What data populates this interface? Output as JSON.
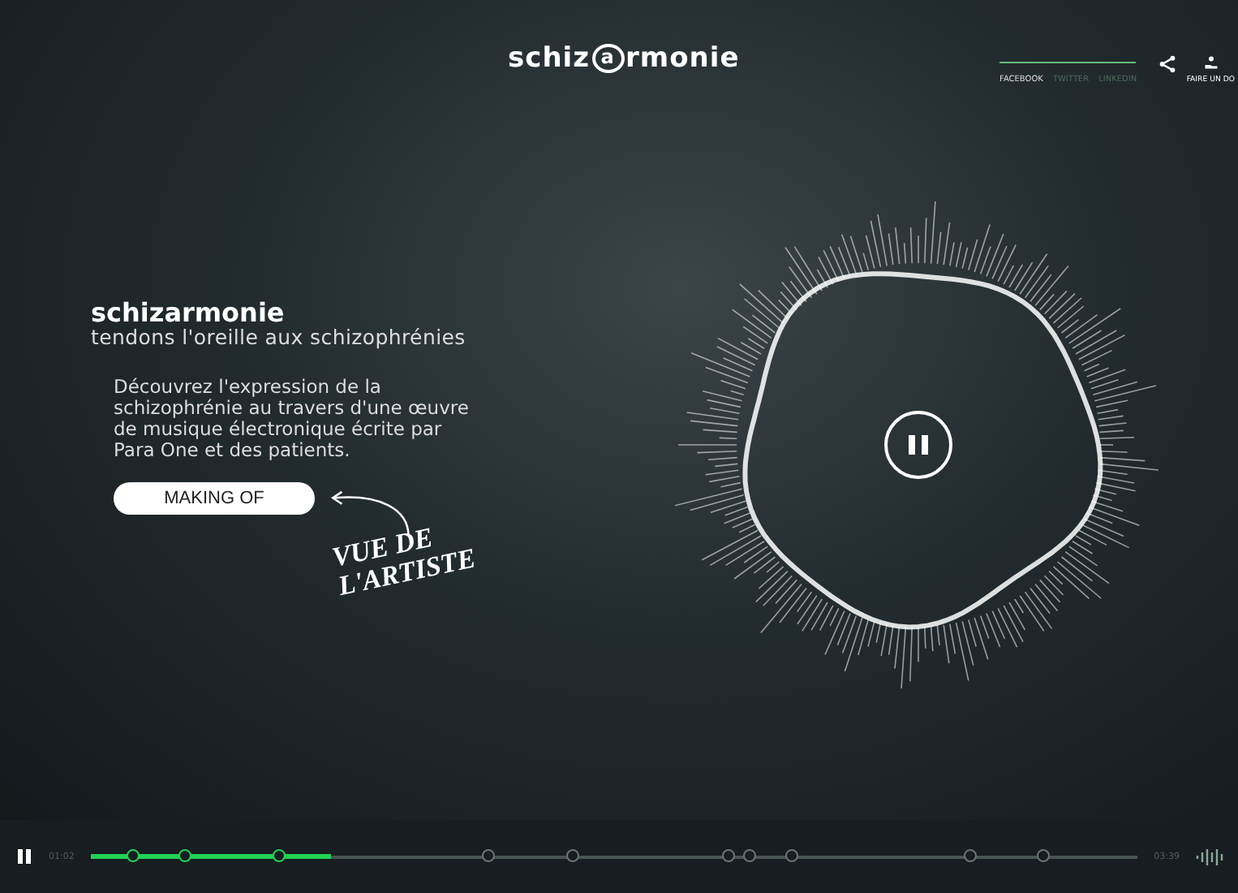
{
  "logo": {
    "before": "schiz",
    "mark": "a",
    "after": "rmonie"
  },
  "share": {
    "links": [
      {
        "label": "FACEBOOK",
        "selected": true
      },
      {
        "label": "TWITTER",
        "selected": false
      },
      {
        "label": "LINKEDIN",
        "selected": false
      }
    ],
    "donate": "FAIRE UN DO"
  },
  "intro": {
    "title": "schizarmonie",
    "subtitle": "tendons l'oreille aux schizophrénies",
    "body": "Découvrez l'expression de la schizophrénie au travers d'une œuvre de musique électronique écrite par Para One et des patients.",
    "button": "MAKING OF",
    "note": [
      "VUE DE",
      "L'ARTISTE"
    ]
  },
  "player": {
    "playing": true,
    "elapsed": "01:02",
    "total": "03:39",
    "level": 0.23,
    "markers": [
      {
        "level": 0.04
      },
      {
        "level": 0.09
      },
      {
        "level": 0.18
      },
      {
        "level": 0.38
      },
      {
        "level": 0.46
      },
      {
        "level": 0.61
      },
      {
        "level": 0.63
      },
      {
        "level": 0.67
      },
      {
        "level": 0.84
      },
      {
        "level": 0.91
      }
    ]
  }
}
